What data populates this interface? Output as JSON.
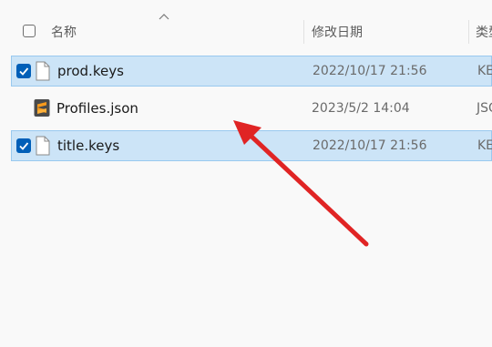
{
  "header": {
    "name_label": "名称",
    "date_label": "修改日期",
    "type_label": "类型"
  },
  "files": [
    {
      "name": "prod.keys",
      "date": "2022/10/17 21:56",
      "type": "KEY",
      "selected": true,
      "icon": "document-icon"
    },
    {
      "name": "Profiles.json",
      "date": "2023/5/2 14:04",
      "type": "JSON",
      "selected": false,
      "icon": "sublime-text-icon"
    },
    {
      "name": "title.keys",
      "date": "2022/10/17 21:56",
      "type": "KEY",
      "selected": true,
      "icon": "document-icon"
    }
  ],
  "colors": {
    "selection_bg": "#cce4f7",
    "checkbox_blue": "#005fb8",
    "annotation_arrow": "#e02424",
    "sublime_orange": "#f89a1c"
  }
}
